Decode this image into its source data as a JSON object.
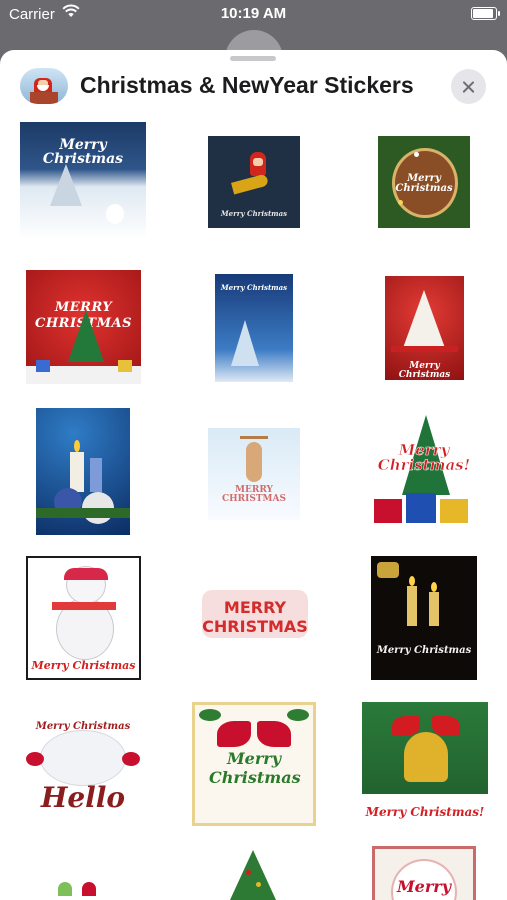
{
  "status_bar": {
    "carrier": "Carrier",
    "time": "10:19 AM"
  },
  "header": {
    "title": "Christmas & NewYear Stickers"
  },
  "stickers": [
    {
      "label": "Merry Christmas",
      "icon": "snowy-night-sticker"
    },
    {
      "label": "Merry Christmas",
      "icon": "santa-rocket-sticker"
    },
    {
      "label": "Merry Christmas",
      "icon": "wreath-sticker"
    },
    {
      "label": "MERRY CHRISTMAS",
      "icon": "tree-red-card-sticker"
    },
    {
      "label": "Merry Christmas",
      "icon": "snowy-forest-sticker"
    },
    {
      "label": "Merry Christmas",
      "icon": "lace-tree-sticker"
    },
    {
      "label": "",
      "icon": "candles-ornaments-sticker"
    },
    {
      "label": "MERRY CHRISTMAS",
      "icon": "reindeer-sticker"
    },
    {
      "label": "Merry Christmas!",
      "icon": "tree-gifts-sticker"
    },
    {
      "label": "Merry Christmas",
      "icon": "snowman-sticker"
    },
    {
      "label": "MERRY CHRISTMAS",
      "icon": "glitter-text-sticker"
    },
    {
      "label": "Merry Christmas",
      "icon": "candle-card-sticker"
    },
    {
      "label": "Merry Christmas",
      "sub": "Hello",
      "icon": "snowmen-hello-sticker"
    },
    {
      "label": "Merry Christmas",
      "icon": "bow-holly-sticker"
    },
    {
      "label": "Merry Christmas!",
      "icon": "golden-bell-sticker"
    },
    {
      "label": "",
      "icon": "elf-sticker"
    },
    {
      "label": "",
      "icon": "small-tree-sticker"
    },
    {
      "label": "Merry",
      "icon": "frame-card-sticker"
    }
  ],
  "colors": {
    "accent_red": "#c8102e",
    "close_bg": "#e6e6ea"
  }
}
